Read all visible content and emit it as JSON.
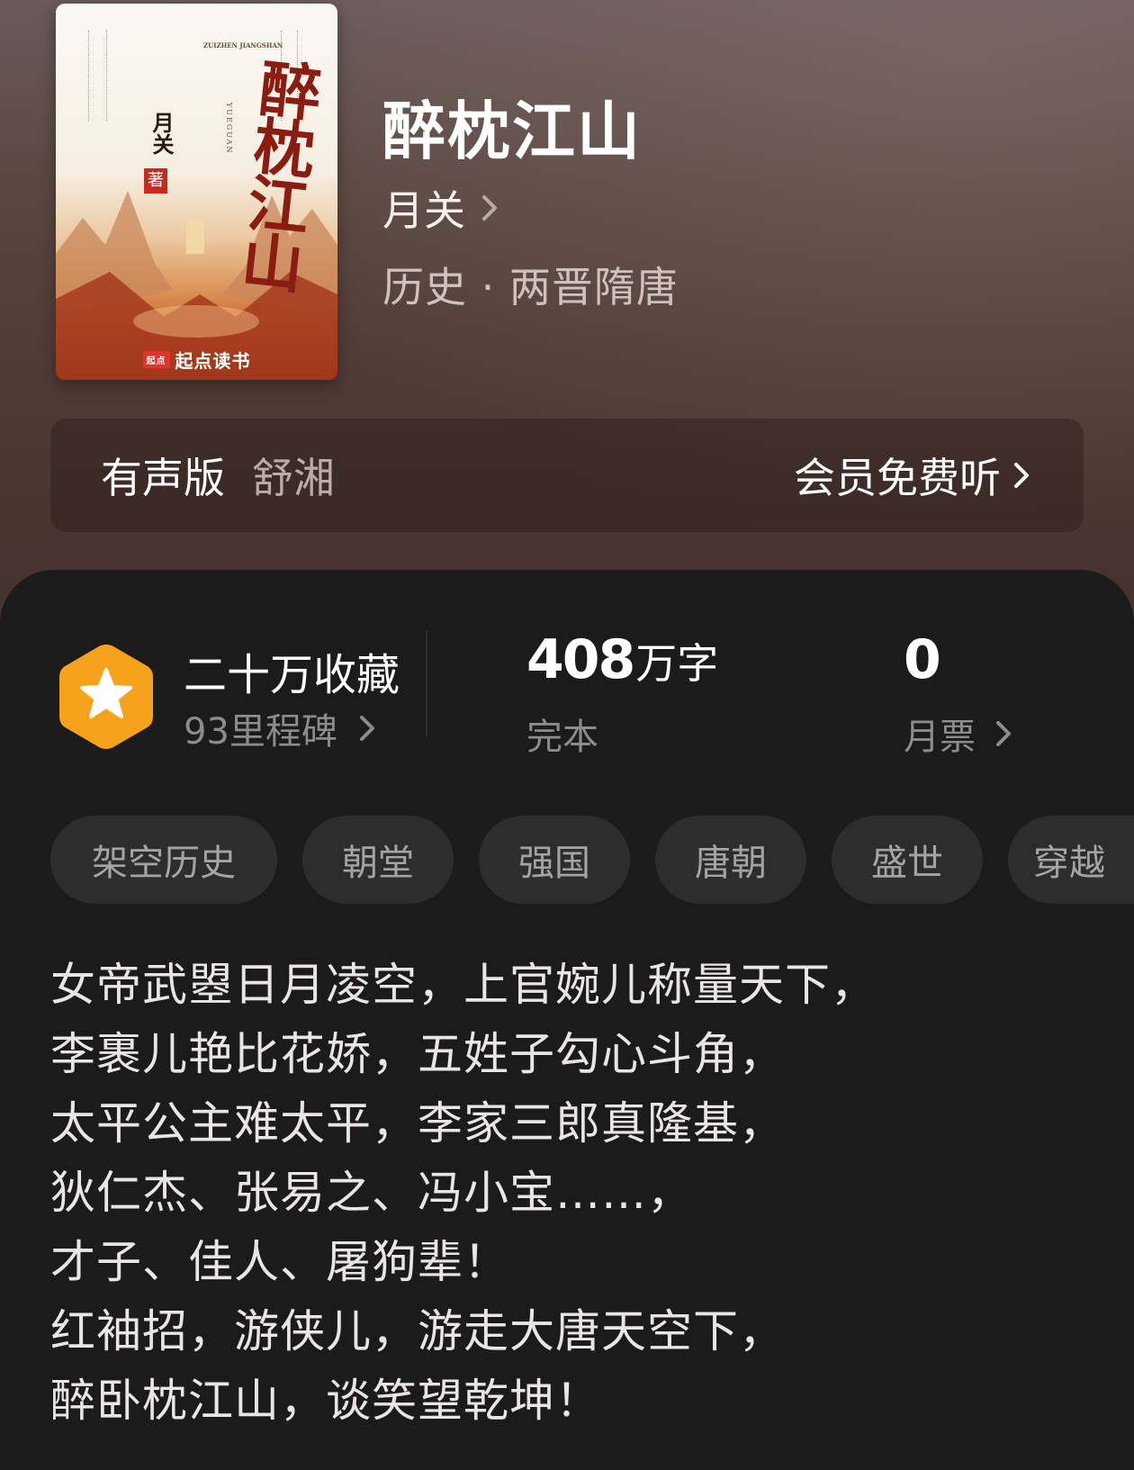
{
  "cover": {
    "title": "醉枕江山",
    "author": "月关",
    "seal": "著",
    "pinyin": "ZUIZHEN JIANGSHAN",
    "pinyin_author": "YUEGUAN",
    "publisher_logo": "起点",
    "publisher": "起点读书"
  },
  "book": {
    "title": "醉枕江山",
    "author": "月关",
    "genre": "历史 · 两晋隋唐"
  },
  "audio": {
    "label": "有声版",
    "narrator": "舒湘",
    "action": "会员免费听"
  },
  "stats": {
    "favorites": "二十万收藏",
    "milestones": "93里程碑",
    "word_count": "408",
    "word_unit": "万字",
    "status": "完本",
    "monthly_tickets": "0",
    "monthly_tickets_label": "月票"
  },
  "tags": [
    "架空历史",
    "朝堂",
    "强国",
    "唐朝",
    "盛世",
    "穿越"
  ],
  "description": [
    "女帝武曌日月凌空，上官婉儿称量天下，",
    "李裹儿艳比花娇，五姓子勾心斗角，",
    "太平公主难太平，李家三郎真隆基，",
    "狄仁杰、张易之、冯小宝……，",
    "才子、佳人、屠狗辈！",
    "红袖招，游侠儿，游走大唐天空下，",
    "醉卧枕江山，谈笑望乾坤！"
  ],
  "colors": {
    "hero_top": "#6a5a59",
    "hero_bottom": "#45312e",
    "panel": "#1c1b1b",
    "tag_bg": "#2e2d2d",
    "badge": "#f6a21a",
    "cover_accent": "#8b1c12"
  }
}
